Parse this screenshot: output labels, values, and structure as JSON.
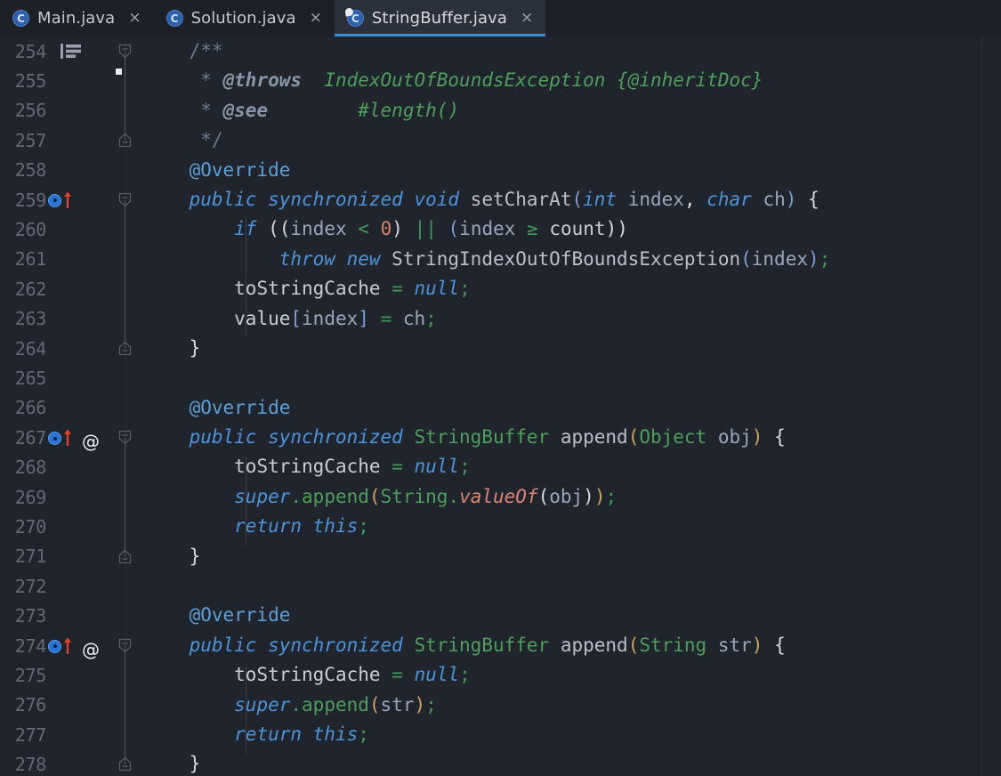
{
  "window": {
    "theme": "IntelliJ Darcula",
    "background": "#20242c",
    "tabbar_background": "#1d2026",
    "active_tab_background": "#2b313b",
    "active_tab_underline": "#3d90d6"
  },
  "tabs": [
    {
      "label": "Main.java",
      "icon": "java-class-icon",
      "active": false,
      "close_label": "×"
    },
    {
      "label": "Solution.java",
      "icon": "java-class-icon",
      "active": false,
      "close_label": "×"
    },
    {
      "label": "StringBuffer.java",
      "icon": "java-library-class-icon",
      "active": true,
      "close_label": "×"
    }
  ],
  "editor": {
    "file": "StringBuffer.java",
    "first_visible_line": 254,
    "last_visible_line": 278,
    "lines": [
      {
        "no": "254",
        "gutter": "javadoc-block-icon",
        "fold": "fold-start",
        "text": "    /**"
      },
      {
        "no": "255",
        "gutter": "",
        "fold": "spine",
        "text": "     * @throws  IndexOutOfBoundsException {@inheritDoc}"
      },
      {
        "no": "256",
        "gutter": "",
        "fold": "spine",
        "text": "     * @see        #length()"
      },
      {
        "no": "257",
        "gutter": "",
        "fold": "fold-end",
        "text": "     */"
      },
      {
        "no": "258",
        "gutter": "",
        "fold": "",
        "text": "    @Override"
      },
      {
        "no": "259",
        "gutter": "override-icon",
        "fold": "fold-start",
        "text": "    public synchronized void setCharAt(int index, char ch) {"
      },
      {
        "no": "260",
        "gutter": "",
        "fold": "spine",
        "text": "        if ((index < 0) || (index >= count))"
      },
      {
        "no": "261",
        "gutter": "",
        "fold": "spine",
        "text": "            throw new StringIndexOutOfBoundsException(index);"
      },
      {
        "no": "262",
        "gutter": "",
        "fold": "spine",
        "text": "        toStringCache = null;"
      },
      {
        "no": "263",
        "gutter": "",
        "fold": "spine",
        "text": "        value[index] = ch;"
      },
      {
        "no": "264",
        "gutter": "",
        "fold": "fold-end",
        "text": "    }"
      },
      {
        "no": "265",
        "gutter": "",
        "fold": "",
        "text": ""
      },
      {
        "no": "266",
        "gutter": "",
        "fold": "",
        "text": "    @Override"
      },
      {
        "no": "267",
        "gutter": "override-annotation-icon",
        "fold": "fold-start",
        "text": "    public synchronized StringBuffer append(Object obj) {"
      },
      {
        "no": "268",
        "gutter": "",
        "fold": "spine",
        "text": "        toStringCache = null;"
      },
      {
        "no": "269",
        "gutter": "",
        "fold": "spine",
        "text": "        super.append(String.valueOf(obj));"
      },
      {
        "no": "270",
        "gutter": "",
        "fold": "spine",
        "text": "        return this;"
      },
      {
        "no": "271",
        "gutter": "",
        "fold": "fold-end",
        "text": "    }"
      },
      {
        "no": "272",
        "gutter": "",
        "fold": "",
        "text": ""
      },
      {
        "no": "273",
        "gutter": "",
        "fold": "",
        "text": "    @Override"
      },
      {
        "no": "274",
        "gutter": "override-annotation-icon",
        "fold": "fold-start",
        "text": "    public synchronized StringBuffer append(String str) {"
      },
      {
        "no": "275",
        "gutter": "",
        "fold": "spine",
        "text": "        toStringCache = null;"
      },
      {
        "no": "276",
        "gutter": "",
        "fold": "spine",
        "text": "        super.append(str);"
      },
      {
        "no": "277",
        "gutter": "",
        "fold": "spine",
        "text": "        return this;"
      },
      {
        "no": "278",
        "gutter": "",
        "fold": "fold-end",
        "text": "    }"
      }
    ],
    "tokens": {
      "254": [
        {
          "t": "    ",
          "c": "t-ident"
        },
        {
          "t": "/**",
          "c": "t-cmt"
        }
      ],
      "255": [
        {
          "t": "     * ",
          "c": "t-cmt"
        },
        {
          "t": "@throws",
          "c": "t-cmt-tag"
        },
        {
          "t": "  ",
          "c": "t-cmt"
        },
        {
          "t": "IndexOutOfBoundsException {@inheritDoc}",
          "c": "t-cmt-val"
        }
      ],
      "256": [
        {
          "t": "     * ",
          "c": "t-cmt"
        },
        {
          "t": "@see",
          "c": "t-cmt-tag"
        },
        {
          "t": "        ",
          "c": "t-cmt"
        },
        {
          "t": "#length()",
          "c": "t-cmt-val"
        }
      ],
      "257": [
        {
          "t": "     */",
          "c": "t-cmt"
        }
      ],
      "258": [
        {
          "t": "    ",
          "c": "t-ident"
        },
        {
          "t": "@Override",
          "c": "t-anno"
        }
      ],
      "259": [
        {
          "t": "    ",
          "c": "t-ident"
        },
        {
          "t": "public synchronized void",
          "c": "t-kw"
        },
        {
          "t": " ",
          "c": "t-ident"
        },
        {
          "t": "setCharAt",
          "c": "t-ident"
        },
        {
          "t": "(",
          "c": "t-paren2"
        },
        {
          "t": "int",
          "c": "t-kw"
        },
        {
          "t": " ",
          "c": "t-ident"
        },
        {
          "t": "index",
          "c": "t-param"
        },
        {
          "t": ",",
          "c": "t-paren1"
        },
        {
          "t": " ",
          "c": "t-ident"
        },
        {
          "t": "char",
          "c": "t-kw"
        },
        {
          "t": " ",
          "c": "t-ident"
        },
        {
          "t": "ch",
          "c": "t-param"
        },
        {
          "t": ")",
          "c": "t-paren2"
        },
        {
          "t": " ",
          "c": "t-ident"
        },
        {
          "t": "{",
          "c": "t-brace"
        }
      ],
      "260": [
        {
          "t": "        ",
          "c": "t-ident"
        },
        {
          "t": "if",
          "c": "t-kw"
        },
        {
          "t": " ",
          "c": "t-ident"
        },
        {
          "t": "((",
          "c": "t-paren1"
        },
        {
          "t": "index",
          "c": "t-param"
        },
        {
          "t": " ",
          "c": "t-ident"
        },
        {
          "t": "<",
          "c": "t-op"
        },
        {
          "t": " ",
          "c": "t-ident"
        },
        {
          "t": "0",
          "c": "t-num"
        },
        {
          "t": ")",
          "c": "t-paren1"
        },
        {
          "t": " ",
          "c": "t-ident"
        },
        {
          "t": "||",
          "c": "t-op"
        },
        {
          "t": " ",
          "c": "t-ident"
        },
        {
          "t": "(",
          "c": "t-paren2"
        },
        {
          "t": "index",
          "c": "t-param"
        },
        {
          "t": " ",
          "c": "t-ident"
        },
        {
          "t": "≥",
          "c": "t-op"
        },
        {
          "t": " ",
          "c": "t-ident"
        },
        {
          "t": "count",
          "c": "t-field"
        },
        {
          "t": "))",
          "c": "t-paren1"
        }
      ],
      "261": [
        {
          "t": "            ",
          "c": "t-ident"
        },
        {
          "t": "throw new",
          "c": "t-kw"
        },
        {
          "t": " ",
          "c": "t-ident"
        },
        {
          "t": "StringIndexOutOfBoundsException",
          "c": "t-ident"
        },
        {
          "t": "(",
          "c": "t-paren2"
        },
        {
          "t": "index",
          "c": "t-param"
        },
        {
          "t": ")",
          "c": "t-paren2"
        },
        {
          "t": ";",
          "c": "t-semi"
        }
      ],
      "262": [
        {
          "t": "        ",
          "c": "t-ident"
        },
        {
          "t": "toStringCache",
          "c": "t-field"
        },
        {
          "t": " ",
          "c": "t-ident"
        },
        {
          "t": "=",
          "c": "t-op"
        },
        {
          "t": " ",
          "c": "t-ident"
        },
        {
          "t": "null",
          "c": "t-kw"
        },
        {
          "t": ";",
          "c": "t-semi"
        }
      ],
      "263": [
        {
          "t": "        ",
          "c": "t-ident"
        },
        {
          "t": "value",
          "c": "t-field"
        },
        {
          "t": "[",
          "c": "t-paren2"
        },
        {
          "t": "index",
          "c": "t-param"
        },
        {
          "t": "]",
          "c": "t-paren2"
        },
        {
          "t": " ",
          "c": "t-ident"
        },
        {
          "t": "=",
          "c": "t-op"
        },
        {
          "t": " ",
          "c": "t-ident"
        },
        {
          "t": "ch",
          "c": "t-param"
        },
        {
          "t": ";",
          "c": "t-semi"
        }
      ],
      "264": [
        {
          "t": "    ",
          "c": "t-ident"
        },
        {
          "t": "}",
          "c": "t-brace"
        }
      ],
      "265": [],
      "266": [
        {
          "t": "    ",
          "c": "t-ident"
        },
        {
          "t": "@Override",
          "c": "t-anno"
        }
      ],
      "267": [
        {
          "t": "    ",
          "c": "t-ident"
        },
        {
          "t": "public synchronized",
          "c": "t-kw"
        },
        {
          "t": " ",
          "c": "t-ident"
        },
        {
          "t": "StringBuffer",
          "c": "t-class"
        },
        {
          "t": " ",
          "c": "t-ident"
        },
        {
          "t": "append",
          "c": "t-ident"
        },
        {
          "t": "(",
          "c": "t-paren3"
        },
        {
          "t": "Object",
          "c": "t-class"
        },
        {
          "t": " ",
          "c": "t-ident"
        },
        {
          "t": "obj",
          "c": "t-param"
        },
        {
          "t": ")",
          "c": "t-paren3"
        },
        {
          "t": " ",
          "c": "t-ident"
        },
        {
          "t": "{",
          "c": "t-brace"
        }
      ],
      "268": [
        {
          "t": "        ",
          "c": "t-ident"
        },
        {
          "t": "toStringCache",
          "c": "t-field"
        },
        {
          "t": " ",
          "c": "t-ident"
        },
        {
          "t": "=",
          "c": "t-op"
        },
        {
          "t": " ",
          "c": "t-ident"
        },
        {
          "t": "null",
          "c": "t-kw"
        },
        {
          "t": ";",
          "c": "t-semi"
        }
      ],
      "269": [
        {
          "t": "        ",
          "c": "t-ident"
        },
        {
          "t": "super",
          "c": "t-kw"
        },
        {
          "t": ".",
          "c": "t-class"
        },
        {
          "t": "append",
          "c": "t-class"
        },
        {
          "t": "(",
          "c": "t-paren3"
        },
        {
          "t": "String",
          "c": "t-class"
        },
        {
          "t": ".",
          "c": "t-class"
        },
        {
          "t": "valueOf",
          "c": "t-static"
        },
        {
          "t": "(",
          "c": "t-paren1"
        },
        {
          "t": "obj",
          "c": "t-param"
        },
        {
          "t": ")",
          "c": "t-paren1"
        },
        {
          "t": ")",
          "c": "t-paren3"
        },
        {
          "t": ";",
          "c": "t-semi"
        }
      ],
      "270": [
        {
          "t": "        ",
          "c": "t-ident"
        },
        {
          "t": "return this",
          "c": "t-kw"
        },
        {
          "t": ";",
          "c": "t-semi"
        }
      ],
      "271": [
        {
          "t": "    ",
          "c": "t-ident"
        },
        {
          "t": "}",
          "c": "t-brace"
        }
      ],
      "272": [],
      "273": [
        {
          "t": "    ",
          "c": "t-ident"
        },
        {
          "t": "@Override",
          "c": "t-anno"
        }
      ],
      "274": [
        {
          "t": "    ",
          "c": "t-ident"
        },
        {
          "t": "public synchronized",
          "c": "t-kw"
        },
        {
          "t": " ",
          "c": "t-ident"
        },
        {
          "t": "StringBuffer",
          "c": "t-class"
        },
        {
          "t": " ",
          "c": "t-ident"
        },
        {
          "t": "append",
          "c": "t-ident"
        },
        {
          "t": "(",
          "c": "t-paren3"
        },
        {
          "t": "String",
          "c": "t-class"
        },
        {
          "t": " ",
          "c": "t-ident"
        },
        {
          "t": "str",
          "c": "t-param"
        },
        {
          "t": ")",
          "c": "t-paren3"
        },
        {
          "t": " ",
          "c": "t-ident"
        },
        {
          "t": "{",
          "c": "t-brace"
        }
      ],
      "275": [
        {
          "t": "        ",
          "c": "t-ident"
        },
        {
          "t": "toStringCache",
          "c": "t-field"
        },
        {
          "t": " ",
          "c": "t-ident"
        },
        {
          "t": "=",
          "c": "t-op"
        },
        {
          "t": " ",
          "c": "t-ident"
        },
        {
          "t": "null",
          "c": "t-kw"
        },
        {
          "t": ";",
          "c": "t-semi"
        }
      ],
      "276": [
        {
          "t": "        ",
          "c": "t-ident"
        },
        {
          "t": "super",
          "c": "t-kw"
        },
        {
          "t": ".",
          "c": "t-class"
        },
        {
          "t": "append",
          "c": "t-class"
        },
        {
          "t": "(",
          "c": "t-paren3"
        },
        {
          "t": "str",
          "c": "t-param"
        },
        {
          "t": ")",
          "c": "t-paren3"
        },
        {
          "t": ";",
          "c": "t-semi"
        }
      ],
      "277": [
        {
          "t": "        ",
          "c": "t-ident"
        },
        {
          "t": "return this",
          "c": "t-kw"
        },
        {
          "t": ";",
          "c": "t-semi"
        }
      ],
      "278": [
        {
          "t": "    ",
          "c": "t-ident"
        },
        {
          "t": "}",
          "c": "t-brace"
        }
      ]
    }
  }
}
